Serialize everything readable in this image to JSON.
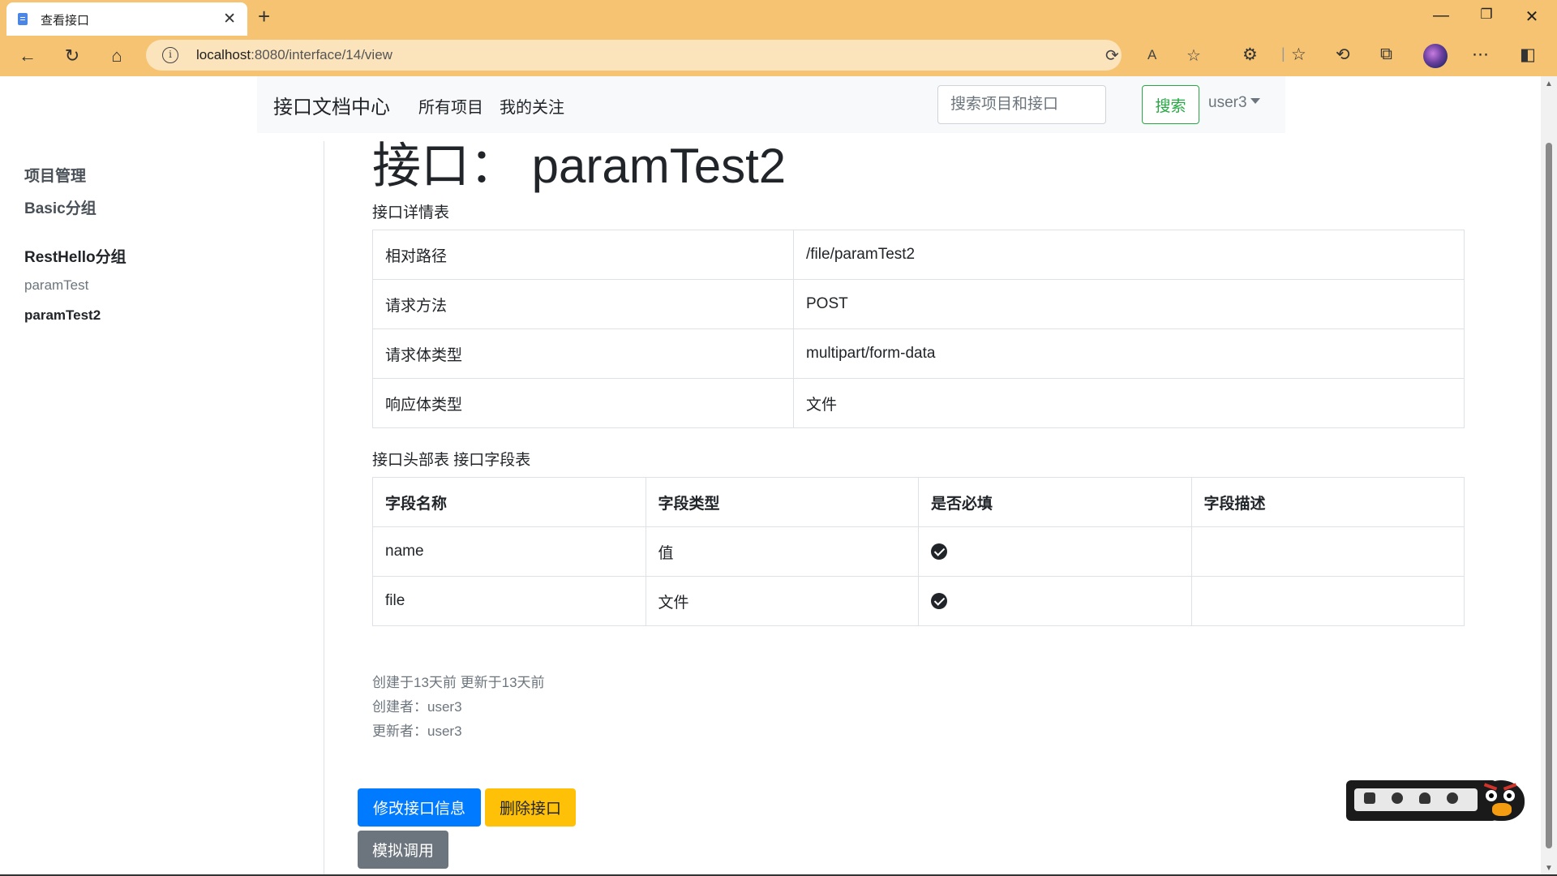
{
  "browser": {
    "tab_title": "查看接口",
    "url_host": "localhost",
    "url_rest": ":8080/interface/14/view"
  },
  "nav": {
    "brand": "接口文档中心",
    "links": [
      "所有项目",
      "我的关注"
    ],
    "search_placeholder": "搜索项目和接口",
    "search_button": "搜索",
    "user": "user3"
  },
  "sidebar": {
    "project_manage": "项目管理",
    "groups": [
      {
        "label": "Basic分组",
        "items": []
      },
      {
        "label": "RestHello分组",
        "items": [
          "paramTest",
          "paramTest2"
        ]
      }
    ],
    "active_item": "paramTest2"
  },
  "main": {
    "title": "接口： paramTest2",
    "detail_caption": "接口详情表",
    "detail_rows": [
      {
        "key": "相对路径",
        "value": "/file/paramTest2"
      },
      {
        "key": "请求方法",
        "value": "POST"
      },
      {
        "key": "请求体类型",
        "value": "multipart/form-data"
      },
      {
        "key": "响应体类型",
        "value": "文件"
      }
    ],
    "fields_caption": "接口头部表 接口字段表",
    "fields_headers": [
      "字段名称",
      "字段类型",
      "是否必填",
      "字段描述"
    ],
    "fields_rows": [
      {
        "name": "name",
        "type": "值",
        "required": true,
        "desc": ""
      },
      {
        "name": "file",
        "type": "文件",
        "required": true,
        "desc": ""
      }
    ],
    "meta": {
      "times": "创建于13天前 更新于13天前",
      "creator": "创建者：user3",
      "updater": "更新者：user3"
    },
    "buttons": {
      "edit": "修改接口信息",
      "delete": "删除接口",
      "simulate": "模拟调用"
    }
  },
  "colors": {
    "browser_chrome": "#f6c372",
    "primary": "#007bff",
    "warning": "#ffc107",
    "secondary": "#6c757d",
    "success": "#28a745"
  }
}
